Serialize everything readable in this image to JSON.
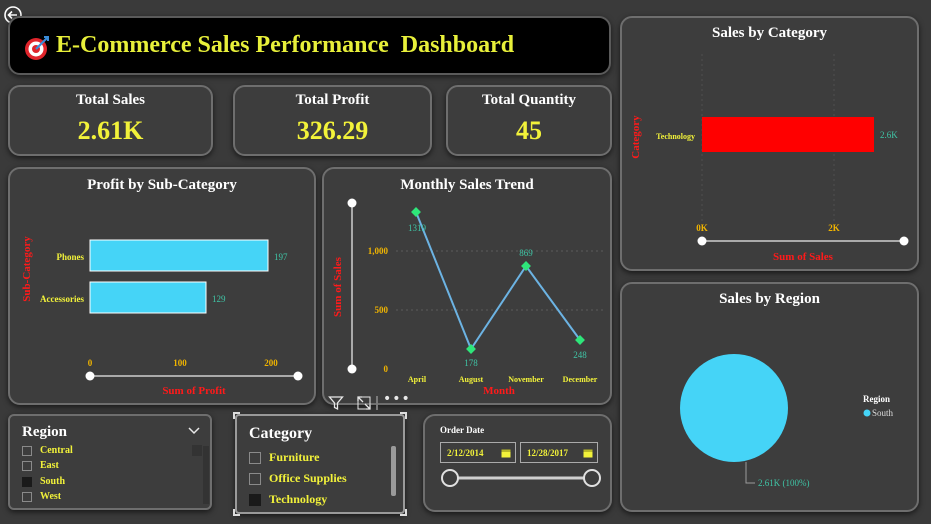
{
  "header": {
    "title": "E-Commerce Sales Performance  Dashboard"
  },
  "kpis": [
    {
      "label": "Total Sales",
      "value": "2.61K"
    },
    {
      "label": "Total Profit",
      "value": "326.29"
    },
    {
      "label": "Total Quantity",
      "value": "45"
    }
  ],
  "profit_chart": {
    "title": "Profit by Sub-Category",
    "ylabel": "Sub-Category",
    "xlabel": "Sum of Profit",
    "ticks": [
      "0",
      "100",
      "200"
    ],
    "bars": [
      {
        "label": "Phones",
        "value": "197"
      },
      {
        "label": "Accessories",
        "value": "129"
      }
    ]
  },
  "trend_chart": {
    "title": "Monthly Sales Trend",
    "ylabel": "Sum of Sales",
    "xlabel": "Month",
    "yticks": [
      "1,000",
      "500",
      "0"
    ],
    "points": [
      {
        "label": "April",
        "value": "1319"
      },
      {
        "label": "August",
        "value": "178"
      },
      {
        "label": "November",
        "value": "869"
      },
      {
        "label": "December",
        "value": "248"
      }
    ]
  },
  "category_chart": {
    "title": "Sales by Category",
    "ylabel": "Category",
    "xlabel": "Sum of Sales",
    "ticks": [
      "0K",
      "2K"
    ],
    "bar_label": "Technology",
    "bar_value": "2.6K"
  },
  "region_chart": {
    "title": "Sales by Region",
    "legend_title": "Region",
    "legend_item": "South",
    "data_label": "2.61K (100%)"
  },
  "region_slicer": {
    "title": "Region",
    "items": [
      {
        "label": "Central",
        "checked": false
      },
      {
        "label": "East",
        "checked": false
      },
      {
        "label": "South",
        "checked": true
      },
      {
        "label": "West",
        "checked": false
      }
    ]
  },
  "category_slicer": {
    "title": "Category",
    "items": [
      {
        "label": "Furniture",
        "checked": false
      },
      {
        "label": "Office Supplies",
        "checked": false
      },
      {
        "label": "Technology",
        "checked": true
      }
    ]
  },
  "date_slicer": {
    "title": "Order Date",
    "start": "2/12/2014",
    "end": "12/28/2017"
  },
  "colors": {
    "accent_yellow": "#f2f23a",
    "bar_cyan": "#45d4f7",
    "bar_red": "#ff0000",
    "axis_red": "#ff1a1a",
    "tick_orange": "#f0b400",
    "label_teal": "#3fc5a6",
    "marker_green": "#2ee67a",
    "pie_cyan": "#45d4f7"
  },
  "chart_data": [
    {
      "type": "bar",
      "title": "Profit by Sub-Category",
      "categories": [
        "Phones",
        "Accessories"
      ],
      "values": [
        197,
        129
      ],
      "xlabel": "Sum of Profit",
      "ylabel": "Sub-Category",
      "xlim": [
        0,
        200
      ]
    },
    {
      "type": "line",
      "title": "Monthly Sales Trend",
      "categories": [
        "April",
        "August",
        "November",
        "December"
      ],
      "values": [
        1319,
        178,
        869,
        248
      ],
      "xlabel": "Month",
      "ylabel": "Sum of Sales",
      "ylim": [
        0,
        1350
      ]
    },
    {
      "type": "bar",
      "title": "Sales by Category",
      "categories": [
        "Technology"
      ],
      "values": [
        2610
      ],
      "xlabel": "Sum of Sales",
      "ylabel": "Category",
      "xlim": [
        0,
        2000
      ]
    },
    {
      "type": "pie",
      "title": "Sales by Region",
      "categories": [
        "South"
      ],
      "values": [
        2610
      ]
    }
  ]
}
